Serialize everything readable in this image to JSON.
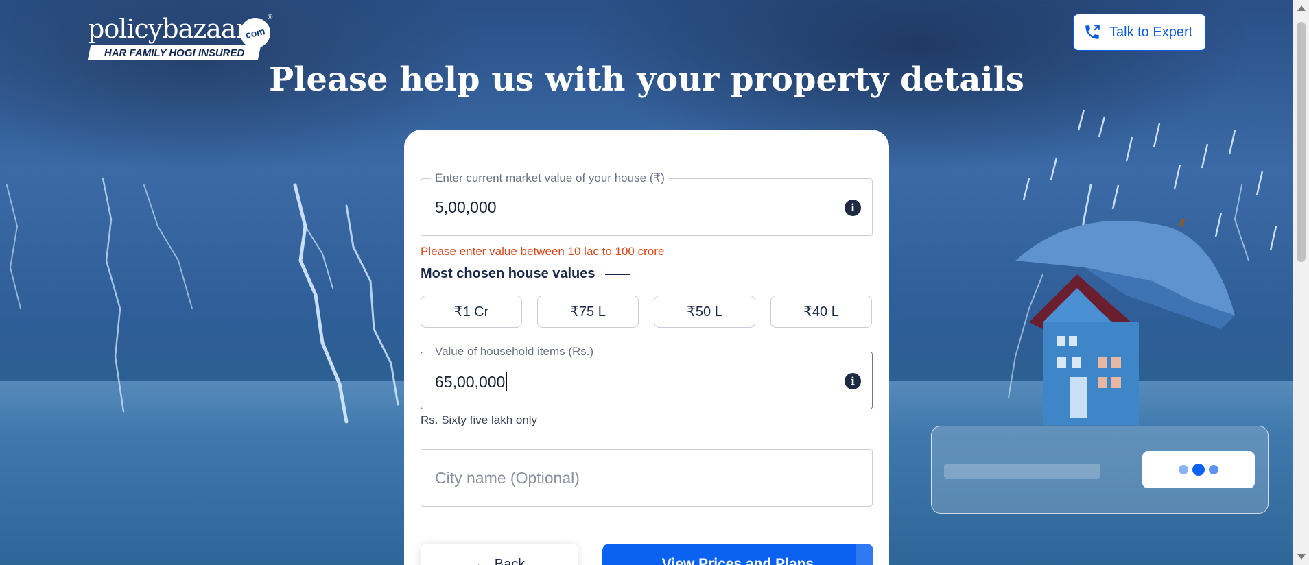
{
  "brand": {
    "logo_text": "policybazaar",
    "logo_com": "com",
    "logo_reg": "®",
    "tagline": "HAR FAMILY HOGI INSURED"
  },
  "header": {
    "expert_button_label": "Talk to Expert"
  },
  "title": "Please help us with your property details",
  "form": {
    "market_value": {
      "label": "Enter current market value of your house (₹)",
      "value": "5,00,000",
      "error": "Please enter value between 10 lac to 100 crore"
    },
    "chosen": {
      "title": "Most chosen house values",
      "options": [
        "₹1 Cr",
        "₹75 L",
        "₹50 L",
        "₹40 L"
      ]
    },
    "household": {
      "label": "Value of household items (Rs.)",
      "value": "65,00,000",
      "helper": "Rs. Sixty five lakh only"
    },
    "city": {
      "placeholder": "City name (Optional)"
    },
    "back_label": "Back",
    "primary_label": "View Prices and Plans"
  },
  "colors": {
    "primary": "#0b62f0",
    "error": "#d9481c",
    "text_dark": "#1b2a4a"
  },
  "icons": {
    "info": "info-icon",
    "phone": "phone-icon",
    "back": "back-arrow-icon"
  }
}
